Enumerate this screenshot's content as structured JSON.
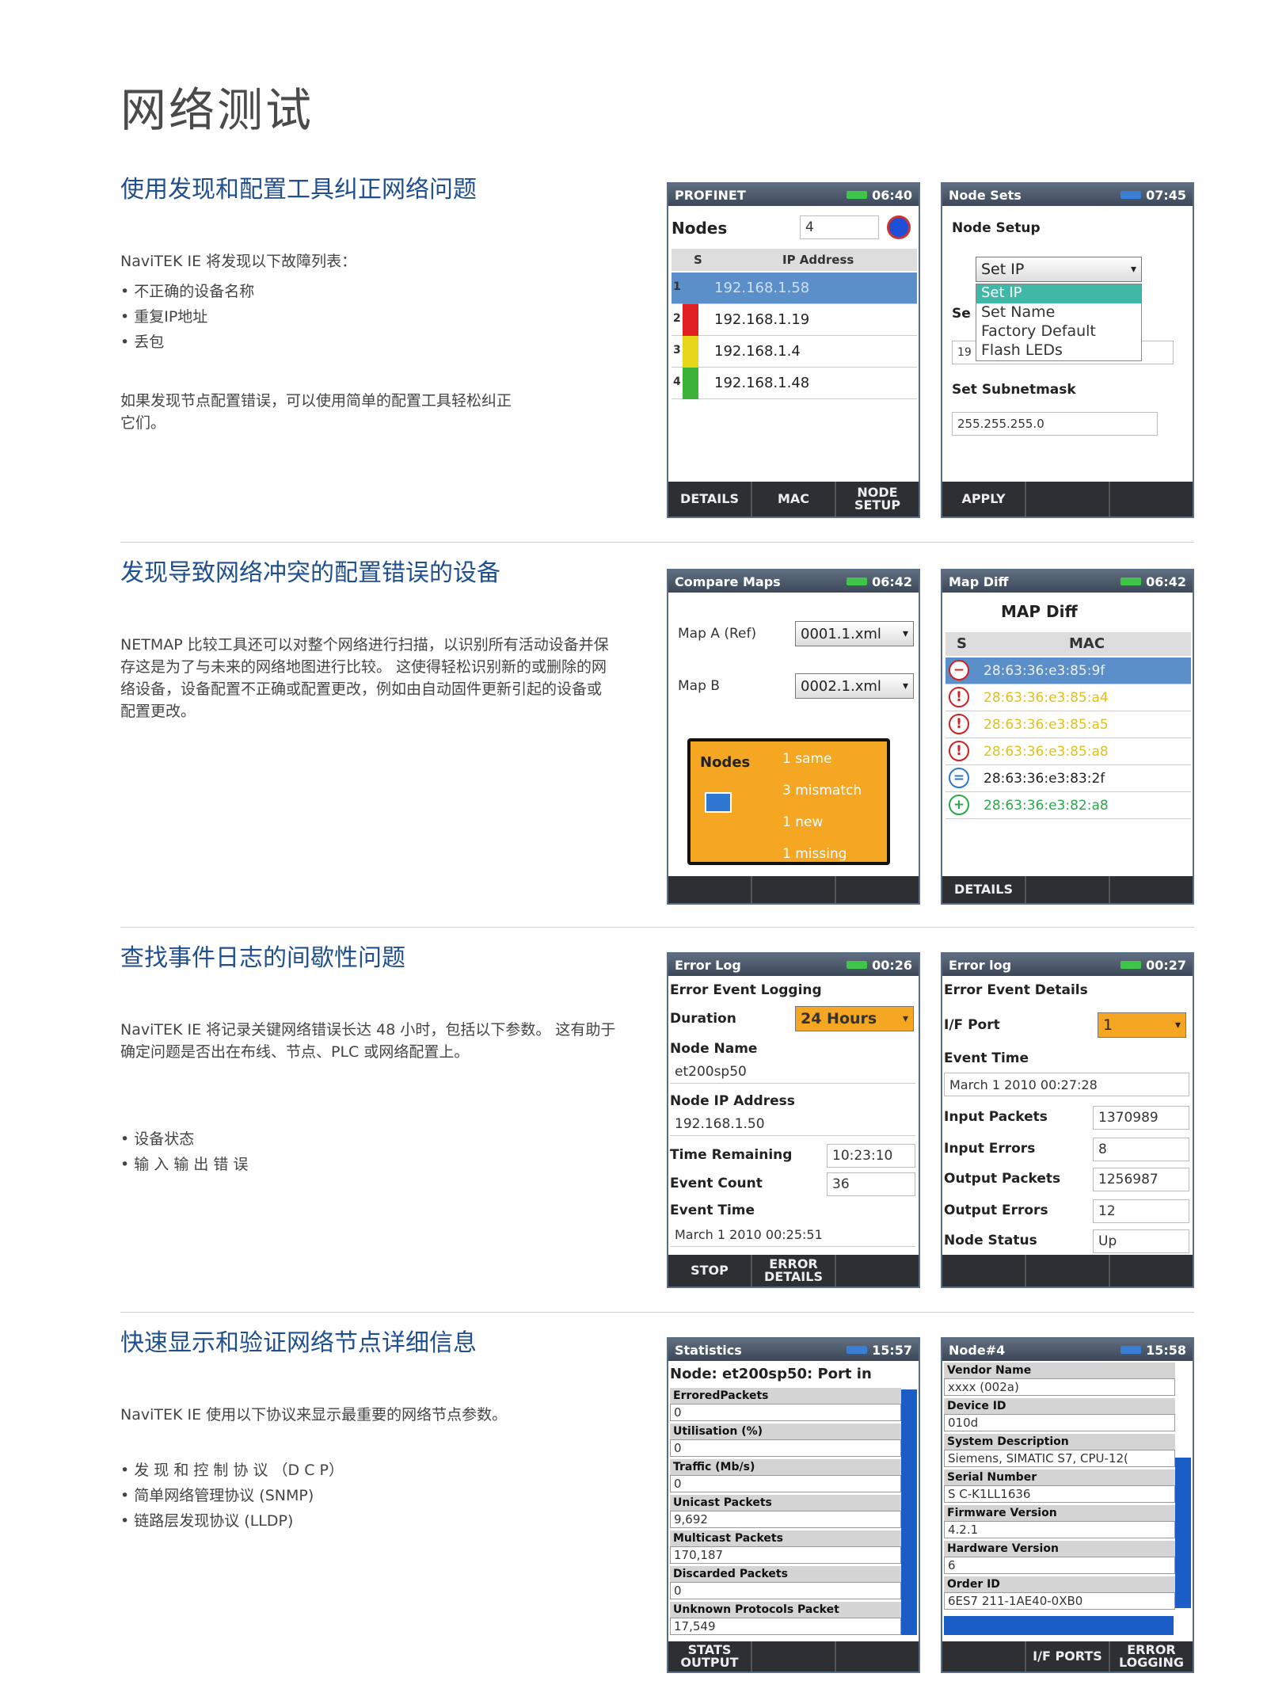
{
  "page_title": "网络测试",
  "sections": [
    {
      "title": "使用发现和配置工具纠正网络问题",
      "intro": "NaviTEK IE 将发现以下故障列表：",
      "bullets": [
        "不正确的设备名称",
        "重复IP地址",
        "丢包"
      ],
      "para": "如果发现节点配置错误，可以使用简单的配置工具轻松纠正它们。"
    },
    {
      "title": "发现导致网络冲突的配置错误的设备",
      "para": "NETMAP 比较工具还可以对整个网络进行扫描，以识别所有活动设备并保存这是为了与未来的网络地图进行比较。 这使得轻松识别新的或删除的网络设备，设备配置不正确或配置更改，例如由自动固件更新引起的设备或配置更改。"
    },
    {
      "title": "查找事件日志的间歇性问题",
      "para": "NaviTEK IE 将记录关键网络错误长达 48 小时，包括以下参数。 这有助于确定问题是否出在布线、节点、PLC 或网络配置上。",
      "bullets": [
        "设备状态",
        "输 入 输 出 错 误"
      ]
    },
    {
      "title": "快速显示和验证网络节点详细信息",
      "para": "NaviTEK IE 使用以下协议来显示最重要的网络节点参数。",
      "bullets": [
        "发 现 和 控 制 协 议 （D C P）",
        "简单网络管理协议 (SNMP)",
        "链路层发现协议 (LLDP)"
      ]
    }
  ],
  "screens": {
    "profinet": {
      "title": "PROFINET",
      "time": "06:40",
      "nodes_label": "Nodes",
      "nodes_value": "4",
      "col_s": "S",
      "col_ip": "IP Address",
      "rows": [
        {
          "n": "1",
          "ip": "192.168.1.58",
          "color": "#5b8fc9"
        },
        {
          "n": "2",
          "ip": "192.168.1.19",
          "color": "#e02020"
        },
        {
          "n": "3",
          "ip": "192.168.1.4",
          "color": "#e8d61a"
        },
        {
          "n": "4",
          "ip": "192.168.1.48",
          "color": "#3bb33b"
        }
      ],
      "buttons": [
        "DETAILS",
        "MAC",
        "NODE SETUP"
      ]
    },
    "node_setup": {
      "title": "Node Sets",
      "time": "07:45",
      "heading": "Node Setup",
      "select_value": "Set IP",
      "options": [
        "Set IP",
        "Set Name",
        "Factory Default",
        "Flash LEDs"
      ],
      "se_label": "Se",
      "ip_prefix": "19",
      "subnet_label": "Set Subnetmask",
      "subnet_value": "255.255.255.0",
      "buttons": [
        "APPLY",
        "",
        ""
      ]
    },
    "compare_maps": {
      "title": "Compare Maps",
      "time": "06:42",
      "map_a_label": "Map A (Ref)",
      "map_a_value": "0001.1.xml",
      "map_b_label": "Map B",
      "map_b_value": "0002.1.xml",
      "nodes_label": "Nodes",
      "stats": [
        "1 same",
        "3 mismatch",
        "1 new",
        "1 missing"
      ],
      "buttons": [
        "",
        "",
        ""
      ]
    },
    "map_diff": {
      "title": "Map Diff",
      "time": "06:42",
      "heading": "MAP Diff",
      "col_s": "S",
      "col_mac": "MAC",
      "rows": [
        {
          "icon": "−",
          "mac": "28:63:36:e3:85:9f",
          "cls": "sel"
        },
        {
          "icon": "!",
          "mac": "28:63:36:e3:85:a4",
          "cls": "warn"
        },
        {
          "icon": "!",
          "mac": "28:63:36:e3:85:a5",
          "cls": "warn"
        },
        {
          "icon": "!",
          "mac": "28:63:36:e3:85:a8",
          "cls": "warn"
        },
        {
          "icon": "=",
          "mac": "28:63:36:e3:83:2f",
          "cls": "ok"
        },
        {
          "icon": "+",
          "mac": "28:63:36:e3:82:a8",
          "cls": "new"
        }
      ],
      "buttons": [
        "DETAILS",
        "",
        ""
      ]
    },
    "error_log": {
      "title": "Error Log",
      "time": "00:26",
      "heading": "Error Event Logging",
      "duration_label": "Duration",
      "duration_value": "24 Hours",
      "node_name_label": "Node Name",
      "node_name_value": "et200sp50",
      "node_ip_label": "Node IP Address",
      "node_ip_value": "192.168.1.50",
      "time_remaining_label": "Time Remaining",
      "time_remaining_value": "10:23:10",
      "event_count_label": "Event Count",
      "event_count_value": "36",
      "event_time_label": "Event Time",
      "event_time_value": "March 1 2010 00:25:51",
      "buttons": [
        "STOP",
        "ERROR DETAILS",
        ""
      ]
    },
    "error_details": {
      "title": "Error log",
      "time": "00:27",
      "heading": "Error Event Details",
      "port_label": "I/F Port",
      "port_value": "1",
      "event_time_label": "Event Time",
      "event_time_value": "March 1 2010 00:27:28",
      "input_packets_label": "Input Packets",
      "input_packets_value": "1370989",
      "input_errors_label": "Input Errors",
      "input_errors_value": "8",
      "output_packets_label": "Output Packets",
      "output_packets_value": "1256987",
      "output_errors_label": "Output Errors",
      "output_errors_value": "12",
      "node_status_label": "Node Status",
      "node_status_value": "Up",
      "buttons": [
        "",
        "",
        ""
      ]
    },
    "statistics": {
      "title": "Statistics",
      "time": "15:57",
      "heading": "Node: et200sp50: Port in",
      "items": [
        {
          "k": "ErroredPackets",
          "v": "0"
        },
        {
          "k": "Utilisation (%)",
          "v": "0"
        },
        {
          "k": "Traffic (Mb/s)",
          "v": "0"
        },
        {
          "k": "Unicast Packets",
          "v": "9,692"
        },
        {
          "k": "Multicast Packets",
          "v": "170,187"
        },
        {
          "k": "Discarded Packets",
          "v": "0"
        },
        {
          "k": "Unknown Protocols Packet",
          "v": "17,549"
        }
      ],
      "buttons": [
        "STATS OUTPUT",
        "",
        ""
      ]
    },
    "node_info": {
      "title": "Node#4",
      "time": "15:58",
      "items": [
        {
          "k": "Vendor Name",
          "v": "xxxx (002a)"
        },
        {
          "k": "Device ID",
          "v": "010d"
        },
        {
          "k": "System Description",
          "v": "Siemens, SIMATIC S7, CPU-12("
        },
        {
          "k": "Serial Number",
          "v": "S C-K1LL1636"
        },
        {
          "k": "Firmware Version",
          "v": "4.2.1"
        },
        {
          "k": "Hardware Version",
          "v": "6"
        },
        {
          "k": "Order ID",
          "v": "6ES7 211-1AE40-0XB0"
        }
      ],
      "buttons": [
        "",
        "I/F PORTS",
        "ERROR LOGGING"
      ]
    }
  }
}
